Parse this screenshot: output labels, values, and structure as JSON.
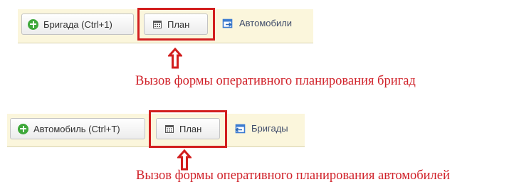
{
  "panel1": {
    "add_button_label": "Бригада (Ctrl+1)",
    "plan_button_label": "План",
    "link_label": "Автомобили",
    "caption": "Вызов формы оперативного планирования бригад"
  },
  "panel2": {
    "add_button_label": "Автомобиль (Ctrl+T)",
    "plan_button_label": "План",
    "link_label": "Бригады",
    "caption": "Вызов формы оперативного планирования автомобилей"
  },
  "colors": {
    "panel_background": "#fbf6dc",
    "highlight": "#d21e1e",
    "caption": "#d0222a",
    "add_icon": "#3ea83a",
    "link_icon": "#3b7bd1"
  },
  "icons": {
    "add": "plus-circle-icon",
    "plan": "calendar-icon",
    "automobiles_link": "arrow-into-box-icon",
    "brigades_link": "arrow-out-of-box-icon",
    "pointer": "up-arrow-icon"
  }
}
